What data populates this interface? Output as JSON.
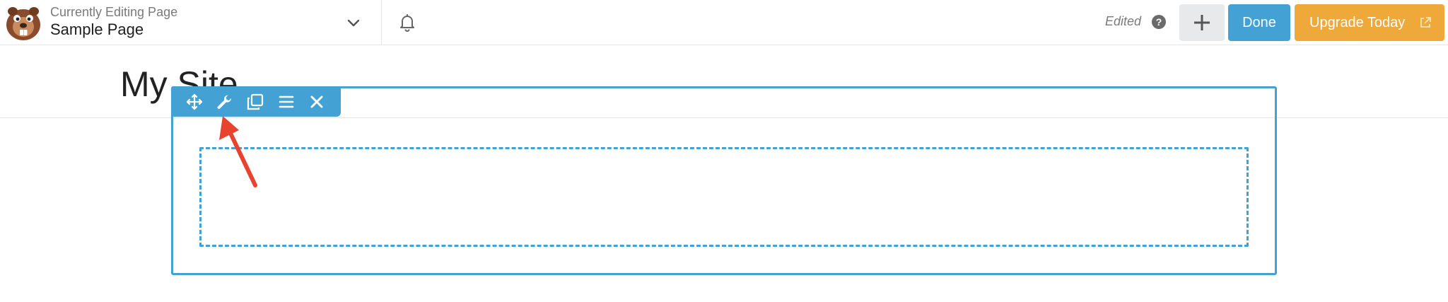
{
  "topbar": {
    "page_label": "Currently Editing Page",
    "page_name": "Sample Page",
    "edited_label": "Edited",
    "help_glyph": "?",
    "done_label": "Done",
    "upgrade_label": "Upgrade Today"
  },
  "site": {
    "title": "My Site"
  },
  "icons": {
    "logo": "beaver-builder-logo",
    "chevron": "chevron-down-icon",
    "bell": "bell-icon",
    "help": "help-icon",
    "add": "plus-icon",
    "external": "external-link-icon",
    "move": "move-icon",
    "settings": "wrench-icon",
    "duplicate": "duplicate-icon",
    "menu": "menu-icon",
    "close": "close-icon"
  },
  "colors": {
    "accent": "#43a2d3",
    "upgrade": "#eea93a",
    "annotation": "#e8432e"
  }
}
